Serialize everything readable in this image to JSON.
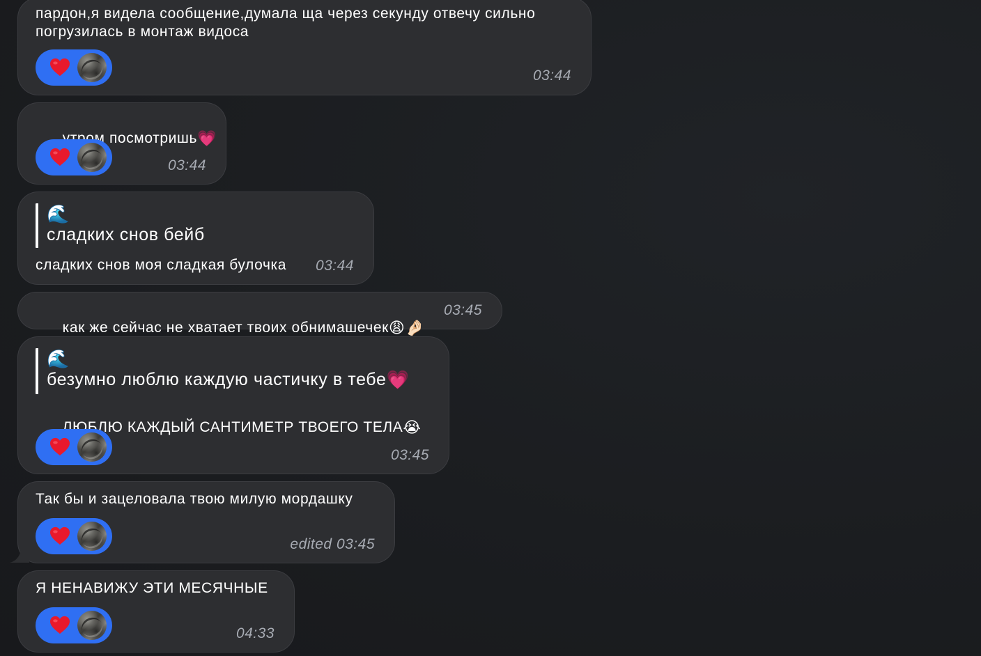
{
  "messages": [
    {
      "text": "пардон,я видела сообщение,думала ща через секунду отвечу сильно\nпогрузилась в монтаж видоса",
      "time": "03:44",
      "reaction": "❤️"
    },
    {
      "text": "утром посмотришь",
      "emoji": "💗",
      "time": "03:44",
      "reaction": "❤️"
    },
    {
      "quote_emoji": "🌊",
      "quote_text": "сладких снов бейб",
      "text": "сладких снов моя сладкая булочка",
      "time": "03:44"
    },
    {
      "text": "как же сейчас не хватает твоих обнимашечек",
      "emoji": "😩🤌🏻",
      "time": "03:45"
    },
    {
      "quote_emoji": "🌊",
      "quote_text": "безумно люблю каждую частичку в тебе",
      "quote_trailing_emoji": "💗",
      "text": "ЛЮБЛЮ КАЖДЫЙ САНТИМЕТР ТВОЕГО ТЕЛА",
      "emoji": "😭",
      "time": "03:45",
      "reaction": "❤️"
    },
    {
      "text": "Так бы и зацеловала твою милую мордашку",
      "time": "edited 03:45",
      "reaction": "❤️"
    },
    {
      "text": "Я НЕНАВИЖУ ЭТИ МЕСЯЧНЫЕ",
      "time": "04:33",
      "reaction": "❤️"
    }
  ],
  "colors": {
    "background": "#1b1d20",
    "bubble": "#2d2e31",
    "reaction_pill": "#2f6ff3",
    "heart": "#e8192c",
    "timestamp": "#a7abb3"
  },
  "icons": {
    "reaction": "heart-icon",
    "reactor": "avatar"
  }
}
